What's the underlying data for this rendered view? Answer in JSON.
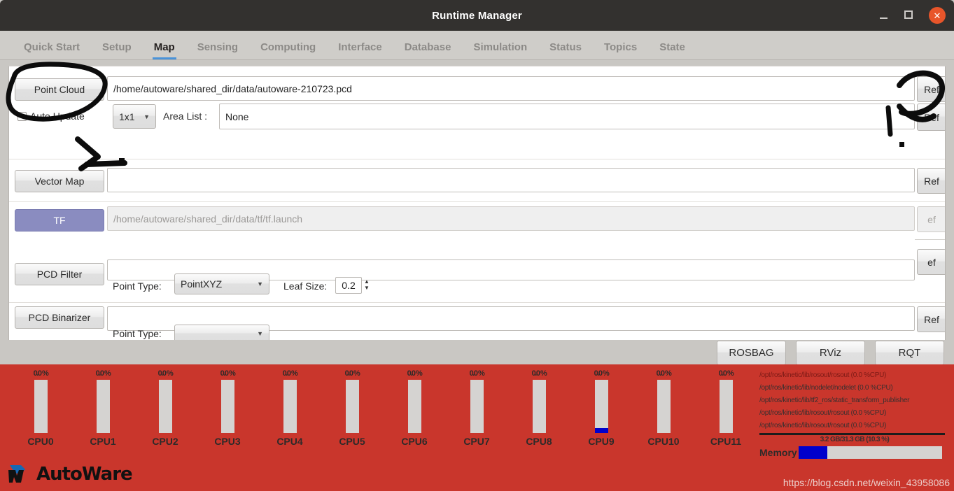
{
  "window": {
    "title": "Runtime Manager",
    "minimize_label": "–",
    "maximize_label": "□",
    "close_label": "✕"
  },
  "tabs": [
    {
      "label": "Quick Start",
      "active": false
    },
    {
      "label": "Setup",
      "active": false
    },
    {
      "label": "Map",
      "active": true
    },
    {
      "label": "Sensing",
      "active": false
    },
    {
      "label": "Computing",
      "active": false
    },
    {
      "label": "Interface",
      "active": false
    },
    {
      "label": "Database",
      "active": false
    },
    {
      "label": "Simulation",
      "active": false
    },
    {
      "label": "Status",
      "active": false
    },
    {
      "label": "Topics",
      "active": false
    },
    {
      "label": "State",
      "active": false
    }
  ],
  "accent": {
    "tab_active": "#4a93d9",
    "titlebar_bg": "#33312f",
    "close_btn": "#e8552a",
    "statusbar_bg": "#c9362c",
    "tf_button": "#8a8cc0",
    "bar_fill": "#0000cc"
  },
  "map": {
    "point_cloud": {
      "button": "Point Cloud",
      "path": "/home/autoware/shared_dir/data/autoware-210723.pcd",
      "ref": "Ref"
    },
    "auto_update": {
      "label": "Auto Update",
      "checked": false,
      "grid": "1x1",
      "area_list_label": "Area List :",
      "area_list_value": "None",
      "ref": "Ref"
    },
    "vector_map": {
      "button": "Vector Map",
      "path": "",
      "ref": "Ref"
    },
    "tf": {
      "button": "TF",
      "path": "/home/autoware/shared_dir/data/tf/tf.launch",
      "ref": "ef"
    },
    "hidden_row": {
      "ref": "ef"
    },
    "pcd_filter": {
      "button": "PCD Filter",
      "path": "",
      "point_type_label": "Point Type:",
      "point_type_value": "PointXYZ",
      "leaf_size_label": "Leaf Size:",
      "leaf_size_value": "0.2"
    },
    "pcd_binarizer": {
      "button": "PCD Binarizer",
      "path": "",
      "ref": "Ref",
      "point_type_label": "Point Type:",
      "point_type_value": ""
    }
  },
  "actions": [
    {
      "label": "ROSBAG"
    },
    {
      "label": "RViz"
    },
    {
      "label": "RQT"
    }
  ],
  "status": {
    "cpus": [
      {
        "name": "CPU0",
        "percent_label": "0.0 %",
        "fill_pct": 0
      },
      {
        "name": "CPU1",
        "percent_label": "0.0 %",
        "fill_pct": 0
      },
      {
        "name": "CPU2",
        "percent_label": "0.0 %",
        "fill_pct": 0
      },
      {
        "name": "CPU3",
        "percent_label": "0.0 %",
        "fill_pct": 0
      },
      {
        "name": "CPU4",
        "percent_label": "0.0 %",
        "fill_pct": 0
      },
      {
        "name": "CPU5",
        "percent_label": "0.0 %",
        "fill_pct": 0
      },
      {
        "name": "CPU6",
        "percent_label": "0.0 %",
        "fill_pct": 0
      },
      {
        "name": "CPU7",
        "percent_label": "0.0 %",
        "fill_pct": 0
      },
      {
        "name": "CPU8",
        "percent_label": "0.0 %",
        "fill_pct": 0
      },
      {
        "name": "CPU9",
        "percent_label": "0.0 %",
        "fill_pct": 9
      },
      {
        "name": "CPU10",
        "percent_label": "0.0 %",
        "fill_pct": 0
      },
      {
        "name": "CPU11",
        "percent_label": "0.0 %",
        "fill_pct": 0
      }
    ],
    "log_lines": [
      "/opt/ros/kinetic/lib/rosout/rosout (0.0 %CPU)",
      "/opt/ros/kinetic/lib/nodelet/nodelet (0.0 %CPU)",
      "/opt/ros/kinetic/lib/tf2_ros/static_transform_publisher",
      "/opt/ros/kinetic/lib/rosout/rosout (0.0 %CPU)",
      "/opt/ros/kinetic/lib/rosout/rosout (0.0 %CPU)"
    ],
    "memory": {
      "label": "Memory",
      "usage_text": "3.2 GB/31.3 GB (10.3 %)",
      "fill_pct": 20
    }
  },
  "brand": {
    "name": "AutoWare"
  },
  "watermark": "https://blog.csdn.net/weixin_43958086"
}
